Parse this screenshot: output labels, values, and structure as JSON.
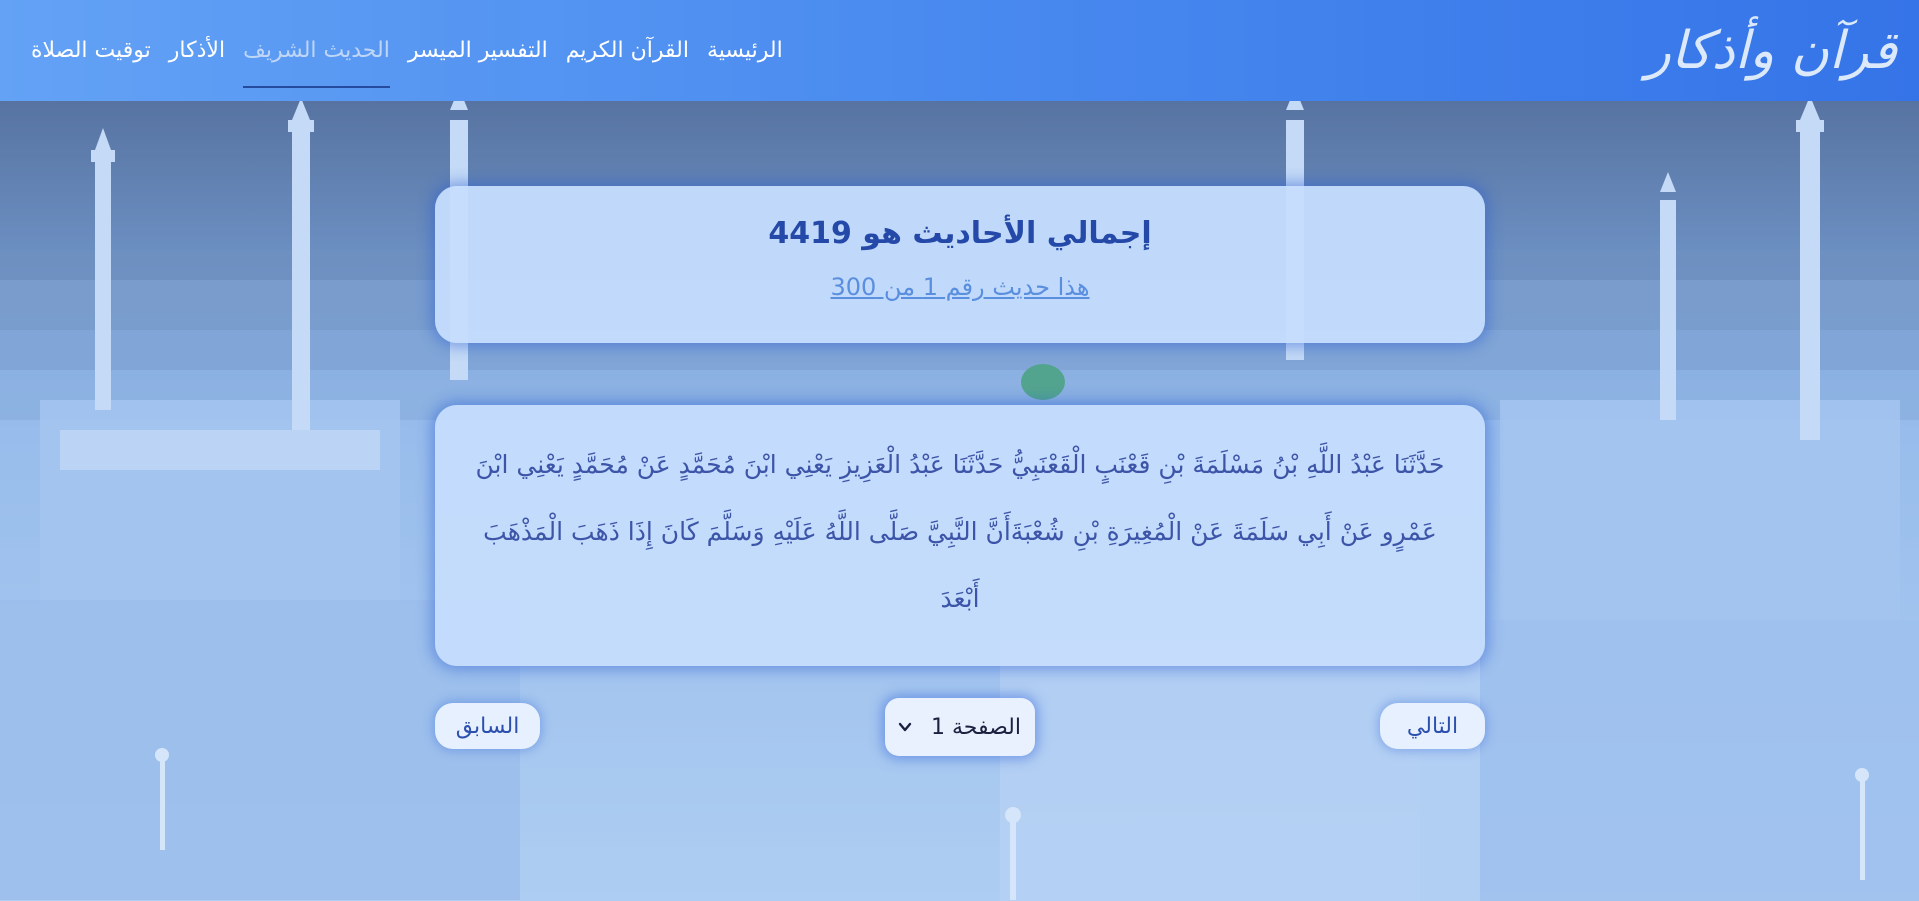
{
  "navbar": {
    "brand": "قرآن وأذكار",
    "links": [
      {
        "label": "الرئيسية",
        "active": false
      },
      {
        "label": "القرآن الكريم",
        "active": false
      },
      {
        "label": "التفسير الميسر",
        "active": false
      },
      {
        "label": "الحديث الشريف",
        "active": true
      },
      {
        "label": "الأذكار",
        "active": false
      },
      {
        "label": "توقيت الصلاة",
        "active": false
      }
    ]
  },
  "summary": {
    "title": "إجمالي الأحاديث هو 4419",
    "subtitle": "هذا حديث رقم 1 من 300"
  },
  "hadith": {
    "text": "حَدَّثَنَا عَبْدُ اللَّهِ بْنُ مَسْلَمَةَ بْنِ قَعْنَبٍ الْقَعْنَبِيُّ حَدَّثَنَا عَبْدُ الْعَزِيزِ يَعْنِي ابْنَ مُحَمَّدٍ عَنْ مُحَمَّدٍ يَعْنِي ابْنَ عَمْرٍو عَنْ أَبِي سَلَمَةَ عَنْ الْمُغِيرَةِ بْنِ شُعْبَةَأَنَّ النَّبِيَّ صَلَّى اللَّهُ عَلَيْهِ وَسَلَّمَ كَانَ إِذَا ذَهَبَ الْمَذْهَبَ أَبْعَدَ"
  },
  "pagination": {
    "next_label": "التالي",
    "prev_label": "السابق",
    "page_select_value": "الصفحة 1"
  },
  "colors": {
    "navbar_start": "#63a2f5",
    "navbar_end": "#3574e8",
    "card_bg": "#c6ddfd",
    "title_text": "#2449a8",
    "link_text": "#5a8fe0",
    "hadith_text": "#3d55a8"
  },
  "icons": {
    "select_arrow": "chevron-down-icon"
  }
}
